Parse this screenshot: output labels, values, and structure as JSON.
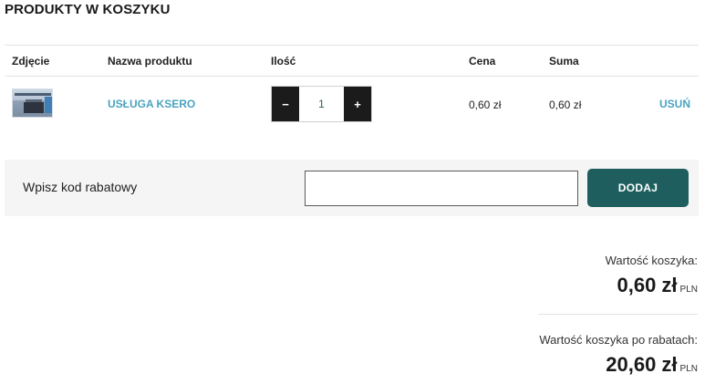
{
  "title": "PRODUKTY W KOSZYKU",
  "table": {
    "headers": {
      "photo": "Zdjęcie",
      "name": "Nazwa produktu",
      "qty": "Ilość",
      "price": "Cena",
      "sum": "Suma"
    },
    "rows": [
      {
        "name": "USŁUGA KSERO",
        "qty_minus": "−",
        "qty_value": "1",
        "qty_plus": "+",
        "price": "0,60 zł",
        "sum": "0,60 zł",
        "remove": "USUŃ"
      }
    ]
  },
  "discount": {
    "label": "Wpisz kod rabatowy",
    "input_value": "",
    "button": "DODAJ"
  },
  "totals": {
    "cart_label": "Wartość koszyka:",
    "cart_value": "0,60 zł",
    "cart_currency": "PLN",
    "after_discount_label": "Wartość koszyka po rabatach:",
    "after_discount_value": "20,60 zł",
    "after_discount_currency": "PLN"
  },
  "colors": {
    "accent_link": "#4aa3bf",
    "button_primary": "#1e5e5f",
    "qty_button": "#1b1b1b"
  }
}
